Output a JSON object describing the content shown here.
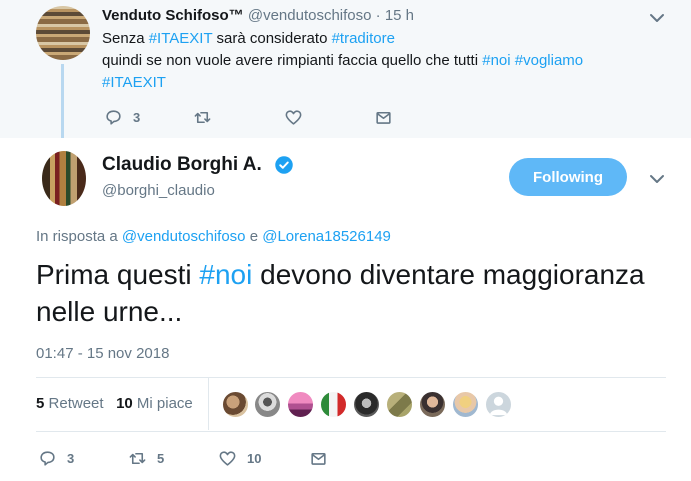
{
  "parent_tweet": {
    "name": "Venduto Schifoso™",
    "handle": "@vendutoschifoso",
    "time": " · 15 h",
    "line1": {
      "t1": "Senza ",
      "h1": "#ITAEXIT",
      "t2": " sarà considerato ",
      "h2": "#traditore"
    },
    "line2": {
      "t1": "quindi se non vuole avere rimpianti faccia quello che tutti ",
      "h1": "#noi",
      "t2": " ",
      "h2": "#vogliamo"
    },
    "line3": {
      "h1": "#ITAEXIT"
    },
    "actions": {
      "reply_count": "3",
      "retweet_count": "",
      "like_count": ""
    }
  },
  "main_tweet": {
    "name": "Claudio Borghi A.",
    "handle": "@borghi_claudio",
    "follow_label": "Following",
    "reply_to": {
      "prefix": "In risposta a ",
      "user1": "@vendutoschifoso",
      "conj": " e ",
      "user2": "@Lorena18526149"
    },
    "text": {
      "t1": "Prima questi ",
      "h1": "#noi",
      "t2": " devono diventare maggioranza nelle urne..."
    },
    "timestamp": "01:47 - 15 nov 2018",
    "stats": {
      "retweets_count": "5",
      "retweets_label": "Retweet",
      "likes_count": "10",
      "likes_label": "Mi piace"
    },
    "actions": {
      "reply_count": "3",
      "retweet_count": "5",
      "like_count": "10"
    }
  },
  "colors": {
    "accent": "#1da1f2",
    "follow_button": "#5fb8f7",
    "muted": "#657786",
    "parent_bg": "#f5f8fa"
  },
  "icons": [
    "reply-icon",
    "retweet-icon",
    "heart-icon",
    "envelope-icon",
    "chevron-down-icon",
    "verified-badge-icon"
  ]
}
